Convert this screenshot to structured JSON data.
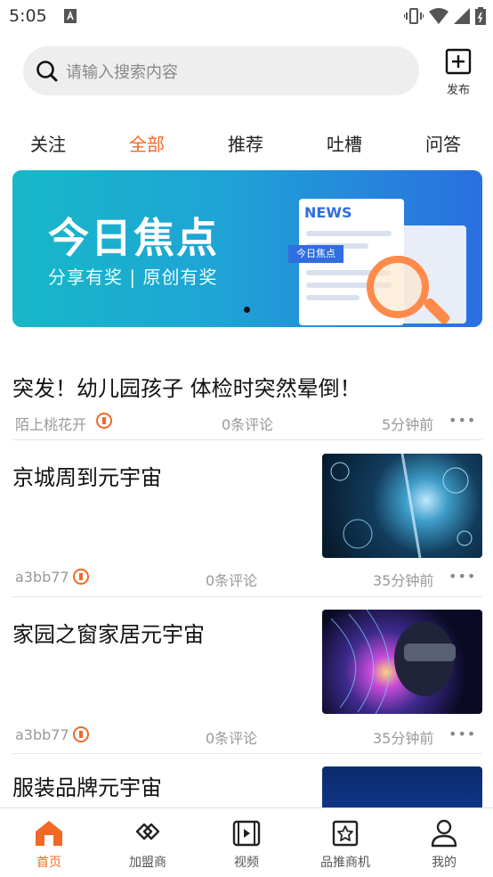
{
  "status_bar": {
    "time": "5:05"
  },
  "search": {
    "placeholder": "请输入搜索内容"
  },
  "publish": {
    "label": "发布"
  },
  "tabs": [
    {
      "label": "关注",
      "active": false
    },
    {
      "label": "全部",
      "active": true
    },
    {
      "label": "推荐",
      "active": false
    },
    {
      "label": "吐槽",
      "active": false
    },
    {
      "label": "问答",
      "active": false
    }
  ],
  "banner": {
    "title": "今日焦点",
    "subtitle": "分享有奖 | 原创有奖",
    "news_label": "NEWS",
    "tag": "今日焦点"
  },
  "articles": [
    {
      "title": "突发！幼儿园孩子 体检时突然晕倒！",
      "author": "陌上桃花开",
      "comments": "0条评论",
      "time": "5分钟前",
      "more": "•••",
      "has_thumb": false
    },
    {
      "title": "京城周到元宇宙",
      "author": "a3bb77",
      "comments": "0条评论",
      "time": "35分钟前",
      "more": "•••",
      "has_thumb": true
    },
    {
      "title": "家园之窗家居元宇宙",
      "author": "a3bb77",
      "comments": "0条评论",
      "time": "35分钟前",
      "more": "•••",
      "has_thumb": true
    },
    {
      "title": "服装品牌元宇宙",
      "has_thumb": true
    }
  ],
  "bottom_nav": [
    {
      "label": "首页",
      "icon": "home-icon",
      "active": true
    },
    {
      "label": "加盟商",
      "icon": "handshake-icon",
      "active": false
    },
    {
      "label": "视频",
      "icon": "video-icon",
      "active": false
    },
    {
      "label": "品推商机",
      "icon": "star-board-icon",
      "active": false
    },
    {
      "label": "我的",
      "icon": "user-icon",
      "active": false
    }
  ],
  "colors": {
    "accent": "#f06a26",
    "text": "#222222",
    "muted": "#999999"
  }
}
